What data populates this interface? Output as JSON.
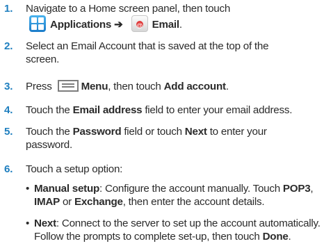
{
  "steps": [
    {
      "number": "1.",
      "line1": "Navigate to a Home screen panel, then touch",
      "apps_label": "Applications",
      "arrow": "➔",
      "email_label": "Email",
      "end": "."
    },
    {
      "number": "2.",
      "line1": "Select an Email Account that is saved at the top of the",
      "line2": "screen."
    },
    {
      "number": "3.",
      "pre": "Press",
      "menu_label": "Menu",
      "mid": ", then touch",
      "add_account": "Add account",
      "end": "."
    },
    {
      "number": "4.",
      "pre": "Touch the",
      "email_address": "Email address",
      "post": "field to enter your email address."
    },
    {
      "number": "5.",
      "pre": "Touch the",
      "password": "Password",
      "mid": "field or touch",
      "next": "Next",
      "post": "to enter your",
      "line2": "password."
    },
    {
      "number": "6.",
      "text": "Touch a setup option:"
    }
  ],
  "options": [
    {
      "bullet": "•",
      "label": "Manual setup",
      "t1": ": Configure the account manually. Touch",
      "pop3": "POP3",
      "comma": ",",
      "imap": "IMAP",
      "or": "or",
      "exchange": "Exchange",
      "t2": ", then enter the account details."
    },
    {
      "bullet": "•",
      "label": "Next",
      "t1": ": Connect to the server to set up the account automatically.",
      "t2": "Follow the prompts to complete set-up, then touch",
      "done": "Done",
      "end": "."
    }
  ],
  "icons": {
    "applications": "applications-grid-icon",
    "email": "email-app-icon",
    "menu": "menu-key-icon"
  },
  "colors": {
    "step_number": "#1f7fbf",
    "text": "#2b2b2b"
  }
}
